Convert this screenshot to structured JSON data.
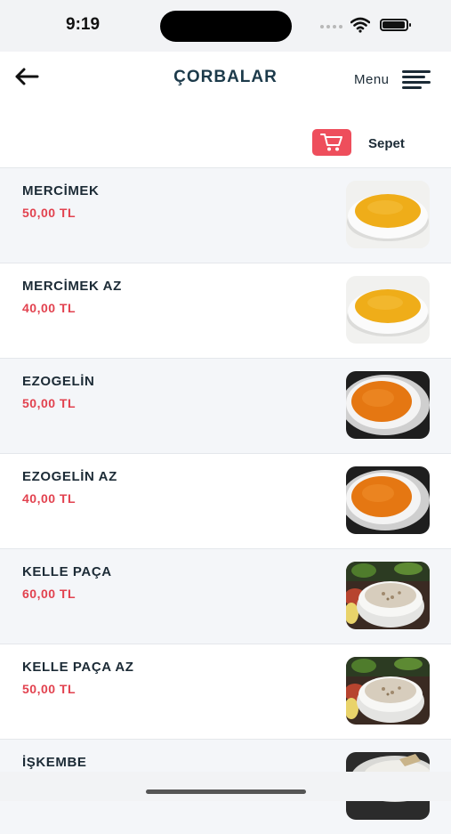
{
  "status": {
    "time": "9:19"
  },
  "header": {
    "title": "ÇORBALAR",
    "menu_label": "Menu",
    "cart_label": "Sepet"
  },
  "colors": {
    "accent": "#ee4e5c",
    "price": "#e2424f",
    "text": "#1c2b36"
  },
  "products": [
    {
      "name": "MERCİMEK",
      "price": "50,00 TL",
      "image": "lentil-soup"
    },
    {
      "name": "MERCİMEK AZ",
      "price": "40,00 TL",
      "image": "lentil-soup"
    },
    {
      "name": "EZOGELİN",
      "price": "50,00 TL",
      "image": "ezogelin-soup"
    },
    {
      "name": "EZOGELİN AZ",
      "price": "40,00 TL",
      "image": "ezogelin-soup"
    },
    {
      "name": "KELLE PAÇA",
      "price": "60,00 TL",
      "image": "kelle-paca-soup"
    },
    {
      "name": "KELLE PAÇA AZ",
      "price": "50,00 TL",
      "image": "kelle-paca-soup"
    },
    {
      "name": "İŞKEMBE",
      "price": "",
      "image": "iskembe-soup"
    }
  ]
}
